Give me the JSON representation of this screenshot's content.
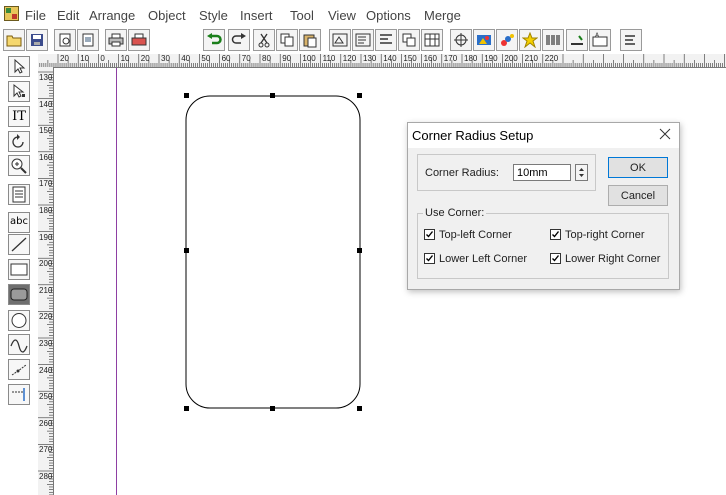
{
  "menu": [
    "File",
    "Edit",
    "Arrange",
    "Object",
    "Style",
    "Insert",
    "Tool",
    "View",
    "Options",
    "Merge"
  ],
  "toolbar_icons": [
    "open-folder-icon",
    "save-icon",
    "print-preview-icon",
    "page-setup-icon",
    "print-icon",
    "export-icon",
    "undo-icon",
    "redo-icon",
    "cut-icon",
    "copy-icon",
    "paste-icon",
    "group-icon",
    "ungroup-icon",
    "align-icon",
    "order-icon",
    "table-icon",
    "move-icon",
    "color-fill-icon",
    "line-color-icon",
    "star-icon",
    "barcode-icon",
    "measure-icon",
    "text-frame-icon",
    "more-icon"
  ],
  "tools": [
    "pointer-tool",
    "node-edit-tool",
    "text-tool",
    "rotate-tool",
    "zoom-tool",
    "page-tool",
    "text-box-tool",
    "line-tool",
    "rectangle-tool",
    "rounded-rectangle-tool",
    "ellipse-tool",
    "curve-tool",
    "polyline-tool",
    "dimension-tool"
  ],
  "tool_labels": {
    "text": "IT",
    "abc": "abc"
  },
  "ruler_top": [
    "20",
    "10",
    "0",
    "10",
    "20",
    "30",
    "40",
    "50",
    "60",
    "70",
    "80",
    "90",
    "100",
    "110",
    "120",
    "130",
    "140",
    "150",
    "160",
    "170",
    "180",
    "190",
    "200",
    "210",
    "220"
  ],
  "ruler_left": [
    "130",
    "140",
    "150",
    "160",
    "170",
    "180",
    "190",
    "200",
    "210",
    "220",
    "230",
    "240",
    "250",
    "260",
    "270",
    "280"
  ],
  "dialog": {
    "title": "Corner Radius Setup",
    "radius_label": "Corner Radius:",
    "radius_value": "10mm",
    "ok": "OK",
    "cancel": "Cancel",
    "use_corner": "Use Corner:",
    "corners": [
      {
        "label": "Top-left Corner",
        "checked": true
      },
      {
        "label": "Top-right Corner",
        "checked": true
      },
      {
        "label": "Lower Left Corner",
        "checked": true
      },
      {
        "label": "Lower Right Corner",
        "checked": true
      }
    ]
  },
  "colors": {
    "page_guide": "#8e3fa3",
    "accent": "#0078d7"
  }
}
